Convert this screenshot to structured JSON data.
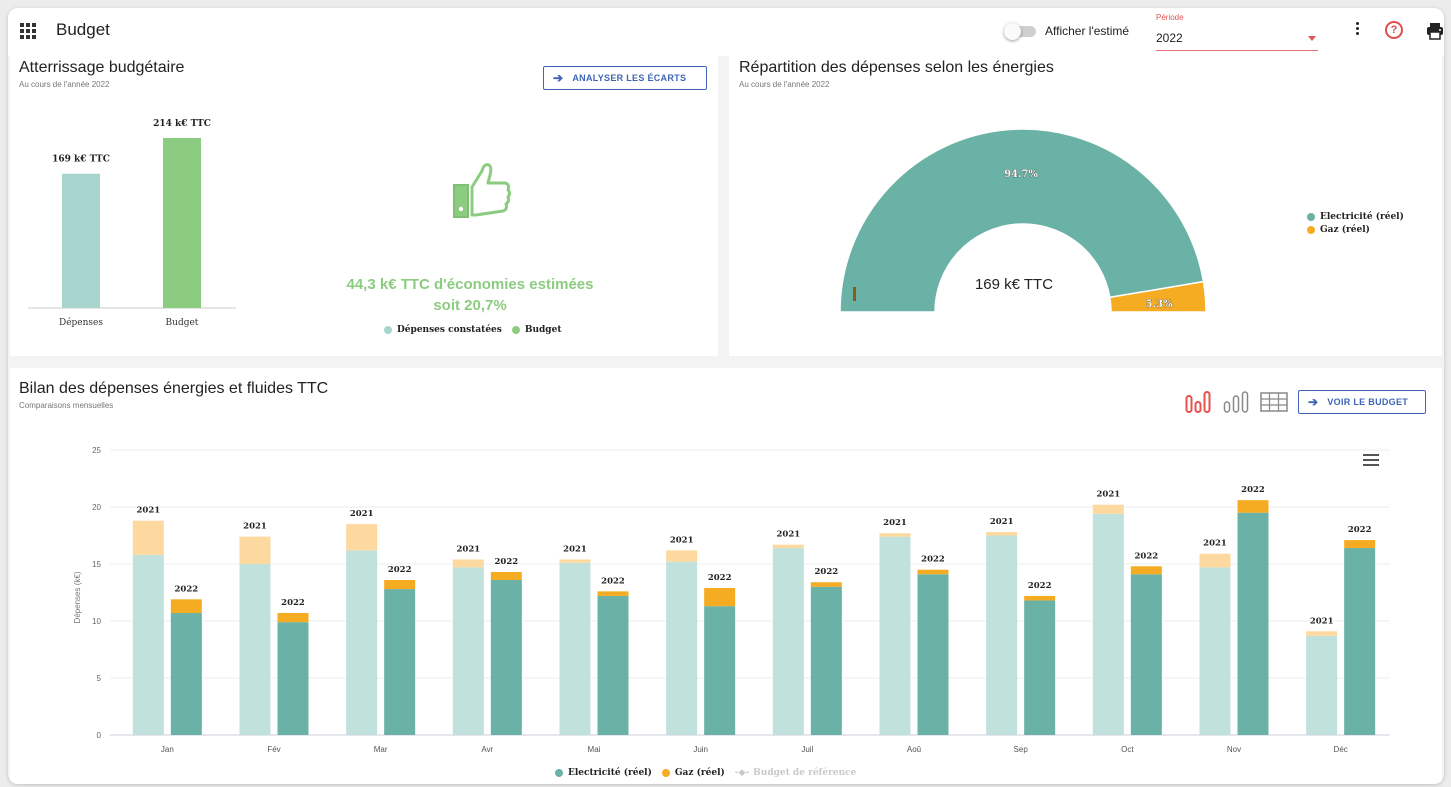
{
  "app": {
    "title": "Budget"
  },
  "header": {
    "toggle_label": "Afficher l'estimé",
    "period_label": "Période",
    "period_value": "2022"
  },
  "landing": {
    "title": "Atterrissage budgétaire",
    "subtitle": "Au cours de l'année 2022",
    "button_label": "ANALYSER LES ÉCARTS",
    "savings_line1": "44,3 k€ TTC d'économies estimées",
    "savings_line2": "soit 20,7%",
    "legend": [
      "Dépenses constatées",
      "Budget"
    ]
  },
  "energy": {
    "title": "Répartition des dépenses selon les énergies",
    "subtitle": "Au cours de l'année 2022",
    "center_label": "169 k€ TTC",
    "legend": [
      "Electricité (réel)",
      "Gaz (réel)"
    ]
  },
  "monthly": {
    "title": "Bilan des dépenses énergies et fluides TTC",
    "subtitle": "Comparaisons mensuelles",
    "button_label": "VOIR LE BUDGET",
    "legend": [
      "Electricité (réel)",
      "Gaz (réel)",
      "Budget de référence"
    ]
  },
  "chart_data": [
    {
      "type": "bar",
      "categories": [
        "Dépenses",
        "Budget"
      ],
      "values": [
        169,
        214
      ],
      "value_labels": [
        "169 k€ TTC",
        "214 k€ TTC"
      ],
      "colors": [
        "#a7d5cd",
        "#8ccc80"
      ]
    },
    {
      "type": "pie",
      "labels": [
        "Electricité (réel)",
        "Gaz (réel)"
      ],
      "values": [
        94.7,
        5.3
      ],
      "value_labels": [
        "94.7%",
        "5.3%"
      ],
      "colors": [
        "#6bb2a6",
        "#f5ac22"
      ]
    },
    {
      "type": "bar",
      "ylabel": "Dépenses (k€)",
      "ylim": [
        0,
        25
      ],
      "yticks": [
        0,
        5,
        10,
        15,
        20,
        25
      ],
      "grid": true,
      "categories": [
        "Jan",
        "Fév",
        "Mar",
        "Avr",
        "Mai",
        "Juin",
        "Juil",
        "Aoû",
        "Sep",
        "Oct",
        "Nov",
        "Déc"
      ],
      "stack_labels": [
        "2021",
        "2022"
      ],
      "series": [
        {
          "name": "Electricité (réel)",
          "year": "2021",
          "color": "#c1e2dc",
          "values": [
            15.8,
            15.0,
            16.2,
            14.7,
            15.1,
            15.2,
            16.4,
            17.4,
            17.5,
            19.4,
            14.7,
            8.7
          ]
        },
        {
          "name": "Gaz (réel)",
          "year": "2021",
          "color": "#fdd9a0",
          "values": [
            3.0,
            2.4,
            2.3,
            0.7,
            0.3,
            1.0,
            0.3,
            0.3,
            0.3,
            0.8,
            1.2,
            0.4
          ]
        },
        {
          "name": "Electricité (réel)",
          "year": "2022",
          "color": "#6bb2a6",
          "values": [
            10.7,
            9.9,
            12.8,
            13.6,
            12.2,
            11.3,
            13.0,
            14.1,
            11.8,
            14.1,
            19.5,
            16.4
          ]
        },
        {
          "name": "Gaz (réel)",
          "year": "2022",
          "color": "#f5ac22",
          "values": [
            1.2,
            0.8,
            0.8,
            0.7,
            0.4,
            1.6,
            0.4,
            0.4,
            0.4,
            0.7,
            1.1,
            0.7
          ]
        }
      ]
    }
  ]
}
